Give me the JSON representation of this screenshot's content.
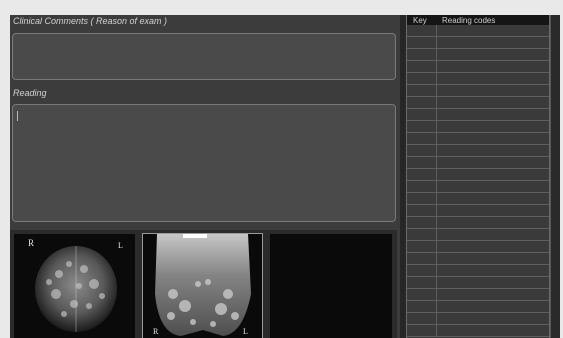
{
  "clinical_comments": {
    "label": "Clinical Comments ( Reason of exam )",
    "value": ""
  },
  "reading": {
    "label": "Reading",
    "value": ""
  },
  "reading_codes": {
    "columns": {
      "key": "Key",
      "codes": "Reading codes"
    },
    "rows": [
      {
        "key": "",
        "code": ""
      },
      {
        "key": "",
        "code": ""
      },
      {
        "key": "",
        "code": ""
      },
      {
        "key": "",
        "code": ""
      },
      {
        "key": "",
        "code": ""
      },
      {
        "key": "",
        "code": ""
      },
      {
        "key": "",
        "code": ""
      },
      {
        "key": "",
        "code": ""
      },
      {
        "key": "",
        "code": ""
      },
      {
        "key": "",
        "code": ""
      },
      {
        "key": "",
        "code": ""
      },
      {
        "key": "",
        "code": ""
      },
      {
        "key": "",
        "code": ""
      },
      {
        "key": "",
        "code": ""
      },
      {
        "key": "",
        "code": ""
      },
      {
        "key": "",
        "code": ""
      },
      {
        "key": "",
        "code": ""
      },
      {
        "key": "",
        "code": ""
      },
      {
        "key": "",
        "code": ""
      },
      {
        "key": "",
        "code": ""
      },
      {
        "key": "",
        "code": ""
      },
      {
        "key": "",
        "code": ""
      },
      {
        "key": "",
        "code": ""
      },
      {
        "key": "",
        "code": ""
      },
      {
        "key": "",
        "code": ""
      },
      {
        "key": "",
        "code": ""
      }
    ]
  },
  "thumbnails": [
    {
      "view": "cc-view",
      "left_marker": "R",
      "right_marker": "L"
    },
    {
      "view": "mlo-view",
      "left_marker": "R",
      "right_marker": "L"
    },
    {
      "view": "empty"
    }
  ],
  "colors": {
    "panel": "#3c3c3c",
    "field": "#4a4a4a",
    "border": "#7a7a7a",
    "label": "#d4d4d4"
  }
}
